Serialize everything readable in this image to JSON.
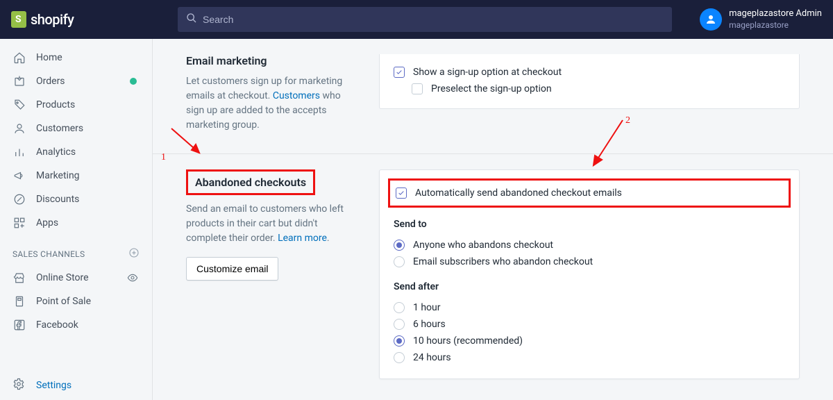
{
  "brand": "shopify",
  "search_placeholder": "Search",
  "user": {
    "name": "mageplazastore Admin",
    "store": "mageplazastore"
  },
  "nav": {
    "home": "Home",
    "orders": "Orders",
    "products": "Products",
    "customers": "Customers",
    "analytics": "Analytics",
    "marketing": "Marketing",
    "discounts": "Discounts",
    "apps": "Apps",
    "sales_channels_head": "SALES CHANNELS",
    "online_store": "Online Store",
    "point_of_sale": "Point of Sale",
    "facebook": "Facebook",
    "settings": "Settings"
  },
  "email_marketing": {
    "title": "Email marketing",
    "desc_pre": "Let customers sign up for marketing emails at checkout. ",
    "link": "Customers",
    "desc_post": " who sign up are added to the accepts marketing group.",
    "opt_signup": "Show a sign-up option at checkout",
    "opt_preselect": "Preselect the sign-up option"
  },
  "abandoned": {
    "title": "Abandoned checkouts",
    "desc_pre": "Send an email to customers who left products in their cart but didn't complete their order. ",
    "link": "Learn more",
    "btn": "Customize email",
    "auto_send": "Automatically send abandoned checkout emails",
    "send_to": "Send to",
    "send_to_anyone": "Anyone who abandons checkout",
    "send_to_subs": "Email subscribers who abandon checkout",
    "send_after": "Send after",
    "h1": "1 hour",
    "h6": "6 hours",
    "h10": "10 hours (recommended)",
    "h24": "24 hours"
  },
  "annotations": {
    "one": "1",
    "two": "2"
  }
}
